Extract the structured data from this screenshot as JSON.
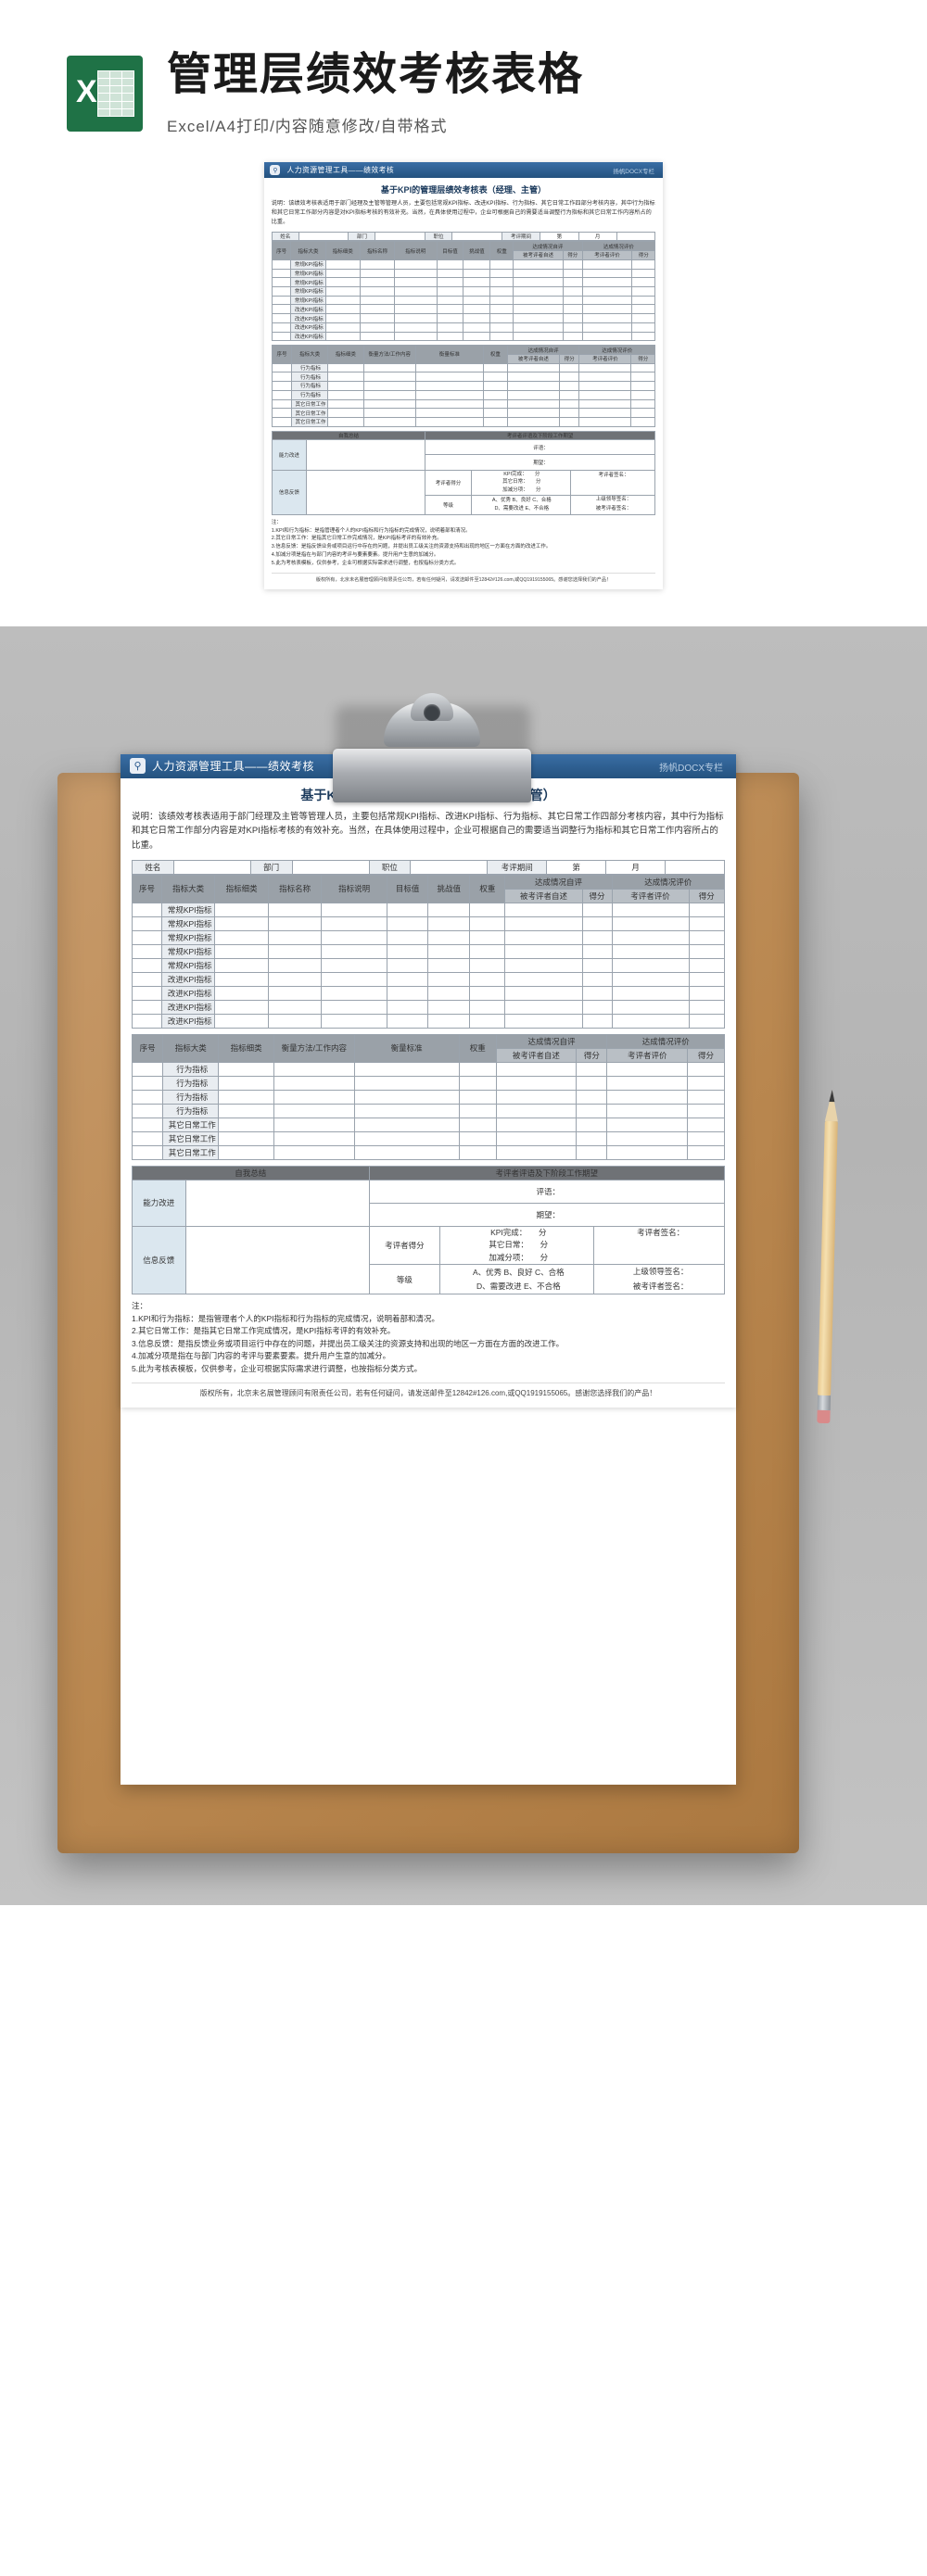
{
  "banner": {
    "logo_letter": "X",
    "title": "管理层绩效考核表格",
    "subtitle": "Excel/A4打印/内容随意修改/自带格式"
  },
  "sheet": {
    "header_icon": "search-icon",
    "header_title": "人力资源管理工具——绩效考核",
    "watermark": "扬帆DOCX专栏",
    "doc_title": "基于KPI的管理层绩效考核表（经理、主管）",
    "note": "说明：该绩效考核表适用于部门经理及主管等管理人员，主要包括常规KPI指标、改进KPI指标、行为指标、其它日常工作四部分考核内容，其中行为指标和其它日常工作部分内容是对KPI指标考核的有效补充。当然，在具体使用过程中，企业可根据自己的需要适当调整行为指标和其它日常工作内容所占的比重。",
    "info_row": {
      "name_label": "姓名",
      "dept_label": "部门",
      "post_label": "职位",
      "period_label": "考评期间",
      "year": "第",
      "month": "月"
    },
    "kpi_table": {
      "headers_row1": [
        "序号",
        "指标大类",
        "指标细类",
        "指标名称",
        "指标说明",
        "目标值",
        "挑战值",
        "权重",
        "达成情况自评",
        "达成情况评价"
      ],
      "headers_row2": [
        "被考评者自述",
        "得分",
        "考评者评价",
        "得分"
      ],
      "rows": [
        "常规KPI指标",
        "常规KPI指标",
        "常规KPI指标",
        "常规KPI指标",
        "常规KPI指标",
        "改进KPI指标",
        "改进KPI指标",
        "改进KPI指标",
        "改进KPI指标"
      ]
    },
    "behavior_table": {
      "headers_row1": [
        "序号",
        "指标大类",
        "指标细类",
        "衡量方法/工作内容",
        "衡量标准",
        "权重",
        "达成情况自评",
        "达成情况评价"
      ],
      "headers_row2": [
        "被考评者自述",
        "得分",
        "考评者评价",
        "得分"
      ],
      "rows": [
        "行为指标",
        "行为指标",
        "行为指标",
        "行为指标",
        "其它日常工作",
        "其它日常工作",
        "其它日常工作"
      ]
    },
    "summary": {
      "left_header": "自我总结",
      "right_header": "考评者评语及下阶段工作期望",
      "row_labels": [
        "能力改进",
        "信息反馈"
      ],
      "comment_label": "评语：",
      "expect_label": "期望：",
      "score_label": "考评者得分",
      "grade_label": "等级",
      "score_items": [
        "KPI完成：　　分",
        "其它日常：　　分",
        "加减分项：　　分"
      ],
      "grade_text_1": "A、优秀  B、良好  C、合格",
      "grade_text_2": "D、需要改进   E、不合格",
      "sign_self": "考评者签名：",
      "sign_leader": "上级领导签名：",
      "sign_assessor": "被考评者签名："
    },
    "footnote_title": "注：",
    "footnotes": [
      "1.KPI和行为指标：是指管理者个人的KPI指标和行为指标的完成情况，说明着部和清况。",
      "2.其它日常工作：是指其它日常工作完成情况，是KPI指标考评的有效补充。",
      "3.信息反馈：是指反馈业务或项目运行中存在的问题，并提出员工级关注的资源支持和出现的地区一方面在方面的改进工作。",
      "4.加减分项是指在与部门内容的考评与要素要素。提升用户生意的加减分。",
      "5.此为考核表模板，仅供参考，企业可根据实际需求进行调整，也按指标分类方式。"
    ],
    "copyright": "版权所有，北京未名展管理顾问有限责任公司，若有任何疑问，请发送邮件至12842#126.com,或QQ1919155065。感谢您选择我们的产品！"
  }
}
